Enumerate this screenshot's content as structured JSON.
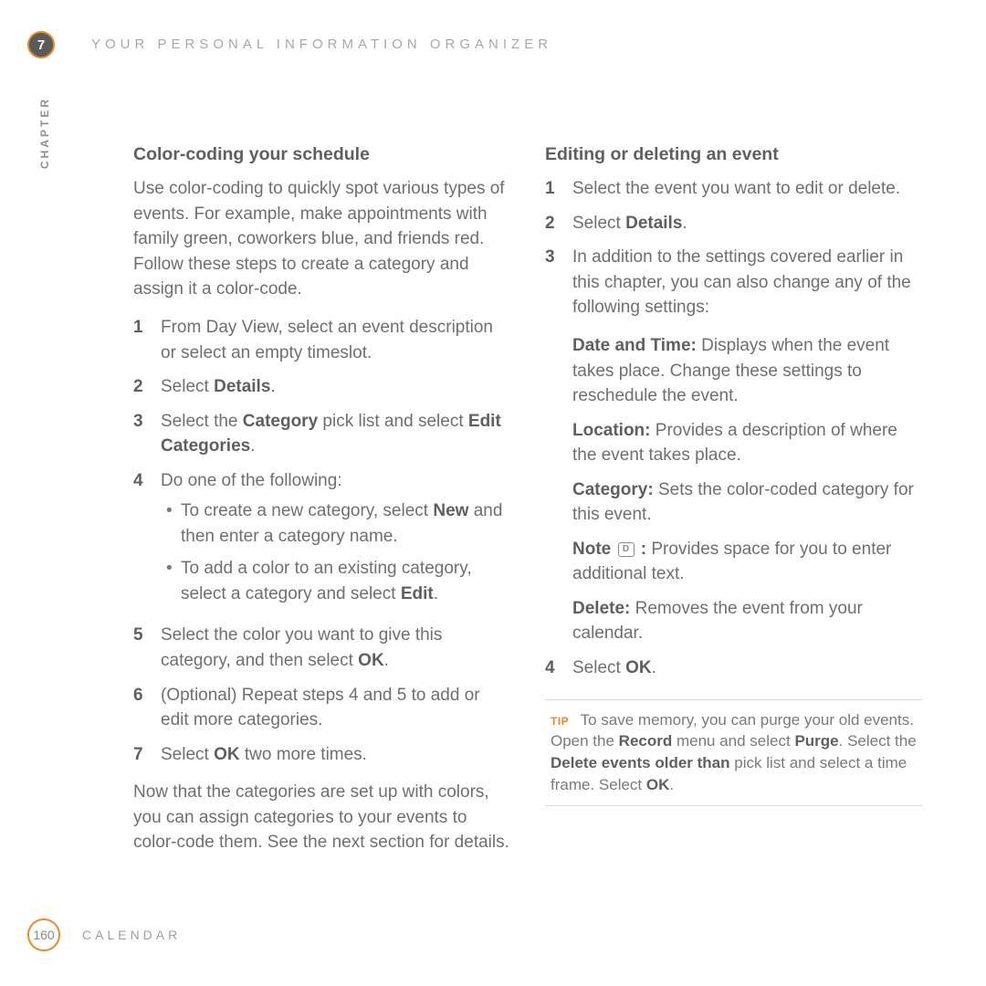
{
  "header": {
    "chapter_number": "7",
    "chapter_label": "CHAPTER",
    "running_title": "YOUR PERSONAL INFORMATION ORGANIZER"
  },
  "left": {
    "heading": "Color-coding your schedule",
    "intro": "Use color-coding to quickly spot various types of events. For example, make appointments with family green, coworkers blue, and friends red. Follow these steps to create a category and assign it a color-code.",
    "steps": {
      "s1": "From Day View, select an event description or select an empty timeslot.",
      "s2_a": "Select ",
      "s2_b": "Details",
      "s2_c": ".",
      "s3_a": "Select the ",
      "s3_b": "Category",
      "s3_c": " pick list and select ",
      "s3_d": "Edit Categories",
      "s3_e": ".",
      "s4": "Do one of the following:",
      "s4_sub1_a": "To create a new category, select ",
      "s4_sub1_b": "New",
      "s4_sub1_c": " and then enter a category name.",
      "s4_sub2_a": "To add a color to an existing category, select a category and select ",
      "s4_sub2_b": "Edit",
      "s4_sub2_c": ".",
      "s5_a": "Select the color you want to give this category, and then select ",
      "s5_b": "OK",
      "s5_c": ".",
      "s6": "(Optional)  Repeat steps 4 and 5 to add or edit more categories.",
      "s7_a": "Select ",
      "s7_b": "OK",
      "s7_c": " two more times."
    },
    "outro": "Now that the categories are set up with colors, you can assign categories to your events to color-code them. See the next section for details."
  },
  "right": {
    "heading": "Editing or deleting an event",
    "steps": {
      "s1": "Select the event you want to edit or delete.",
      "s2_a": "Select ",
      "s2_b": "Details",
      "s2_c": ".",
      "s3": "In addition to the settings covered earlier in this chapter, you can also change any of the following settings:"
    },
    "defs": {
      "dt1": "Date and Time:",
      "dd1": " Displays when the event takes place. Change these settings to reschedule the event.",
      "dt2": "Location:",
      "dd2": " Provides a description of where the event takes place.",
      "dt3": "Category:",
      "dd3": " Sets the color-coded category for this event.",
      "dt4": "Note ",
      "dt4_icon": "D",
      "dt4_colon": " :",
      "dd4": " Provides space for you to enter additional text.",
      "dt5": "Delete:",
      "dd5": " Removes the event from your calendar."
    },
    "step4_a": "Select ",
    "step4_b": "OK",
    "step4_c": ".",
    "tip": {
      "label": "TIP",
      "t1": "To save memory, you can purge your old events. Open the ",
      "b1": "Record",
      "t2": " menu and select ",
      "b2": "Purge",
      "t3": ". Select the ",
      "b3": "Delete events older than",
      "t4": " pick list and select a time frame. Select ",
      "b4": "OK",
      "t5": "."
    }
  },
  "footer": {
    "page_number": "160",
    "section": "CALENDAR"
  }
}
